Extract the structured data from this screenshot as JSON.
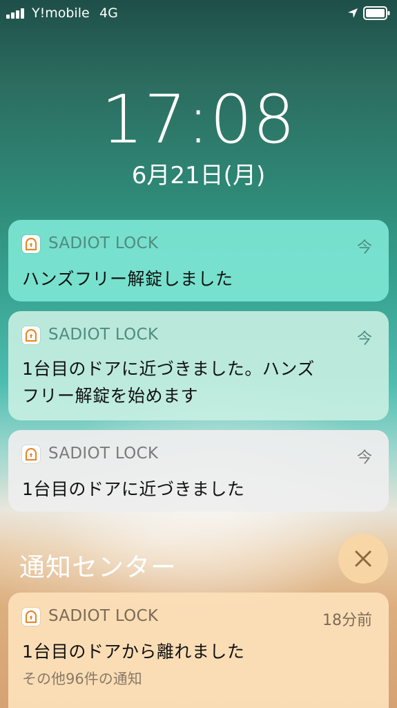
{
  "status_bar": {
    "carrier": "Y!mobile",
    "network": "4G",
    "icons": [
      "signal-bars-icon",
      "location-arrow-icon",
      "battery-icon"
    ]
  },
  "lock_screen": {
    "time": "17:08",
    "date": "6月21日(月)"
  },
  "notifications": [
    {
      "app": "SADIOT LOCK",
      "time": "今",
      "body": "ハンズフリー解錠しました",
      "icon": "lock-app-icon"
    },
    {
      "app": "SADIOT LOCK",
      "time": "今",
      "body_lines": [
        "1台目のドアに近づきました。ハンズ",
        "フリー解錠を始めます"
      ],
      "icon": "lock-app-icon"
    },
    {
      "app": "SADIOT LOCK",
      "time": "今",
      "body": "1台目のドアに近づきました",
      "icon": "lock-app-icon"
    }
  ],
  "notification_center": {
    "title": "通知センター",
    "close_icon": "close-icon",
    "stacked": {
      "app": "SADIOT LOCK",
      "time": "18分前",
      "body": "1台目のドアから離れました",
      "more": "その他96件の通知",
      "icon": "lock-app-icon"
    }
  },
  "colors": {
    "accent_orange": "#e8892b",
    "close_x": "#8a6a3e"
  }
}
